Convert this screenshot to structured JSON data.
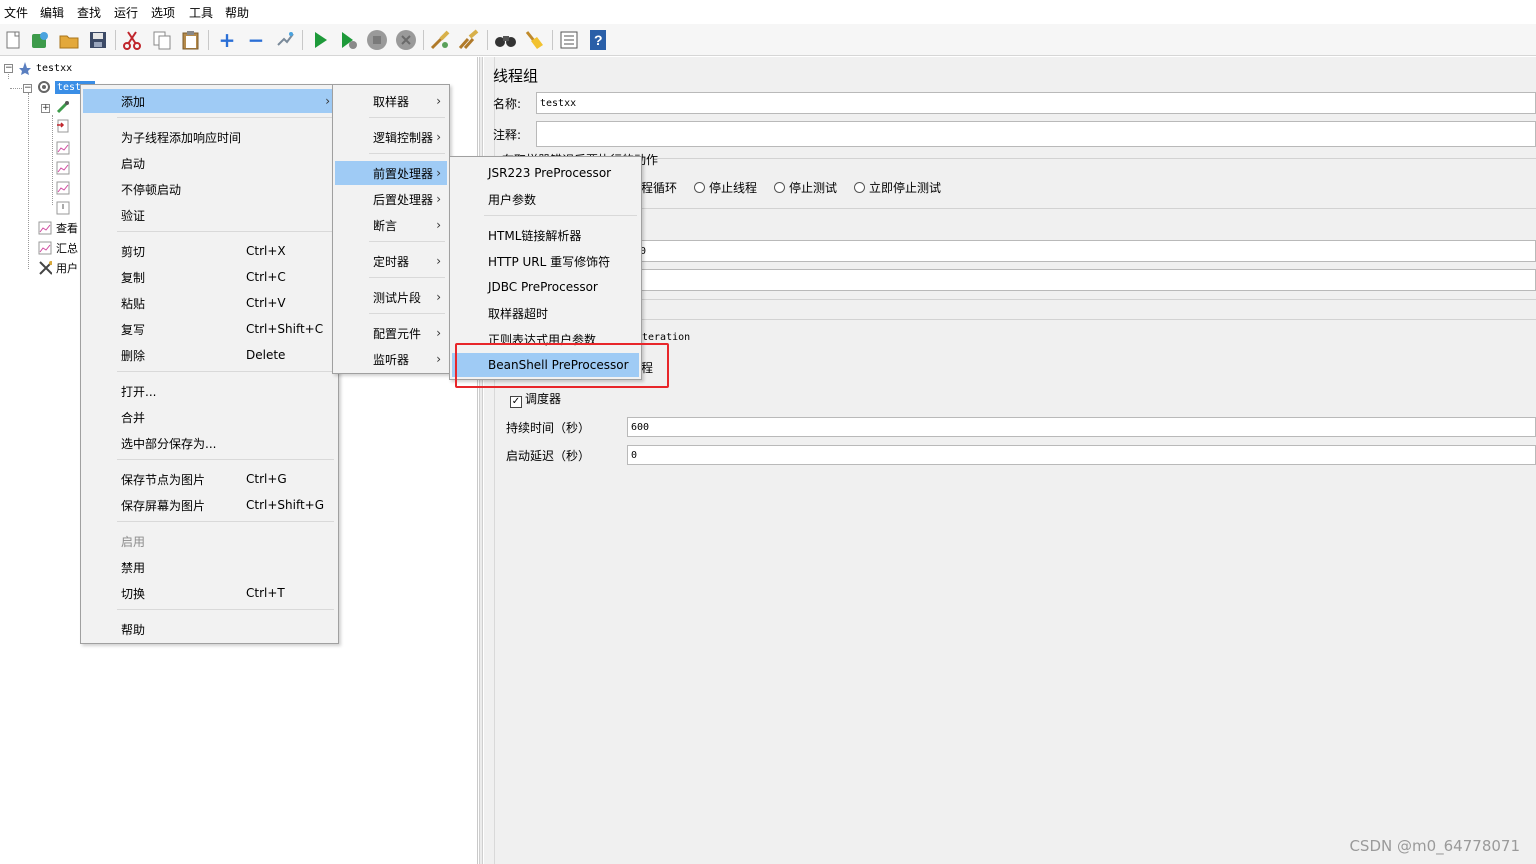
{
  "menubar": {
    "items": [
      "文件",
      "编辑",
      "查找",
      "运行",
      "选项",
      "工具",
      "帮助"
    ]
  },
  "toolbar": {
    "icons": [
      "new-icon",
      "templates-icon",
      "open-icon",
      "save-icon",
      "cut-icon",
      "copy-icon",
      "paste-icon",
      "expand-icon",
      "collapse-icon",
      "toggle-icon",
      "start-icon",
      "start-no-pause-icon",
      "stop-icon",
      "shutdown-icon",
      "clear-icon",
      "clear-all-icon",
      "search-icon",
      "reset-search-icon",
      "function-helper-icon",
      "help-icon"
    ]
  },
  "tree": {
    "root": "testxx",
    "thread_group": "test",
    "listeners": [
      "查看",
      "汇总",
      "用户"
    ]
  },
  "right_panel": {
    "title": "线程组",
    "name_label": "名称:",
    "name_value": "testxx",
    "comment_label": "注释:",
    "comment_value": "",
    "sampler_error_section_partial": "在取样器错误后要执行的动作",
    "radio_partial_continue": "程循环",
    "radio_stop_thread": "停止线程",
    "radio_stop_test": "停止测试",
    "radio_stop_test_now": "立即停止测试",
    "partial_value_1": "0",
    "partial_iteration": "teration",
    "partial_char": "程",
    "scheduler_label": "调度器",
    "scheduler_checked": true,
    "duration_label": "持续时间（秒）",
    "duration_value": "600",
    "startup_delay_label": "启动延迟（秒）",
    "startup_delay_value": "0"
  },
  "context_menu": {
    "items": [
      {
        "label": "添加",
        "shortcut": "",
        "submenu": true,
        "highlighted": true
      },
      {
        "label": "为子线程添加响应时间",
        "shortcut": ""
      },
      {
        "label": "启动",
        "shortcut": ""
      },
      {
        "label": "不停顿启动",
        "shortcut": ""
      },
      {
        "label": "验证",
        "shortcut": ""
      },
      {
        "label": "剪切",
        "shortcut": "Ctrl+X"
      },
      {
        "label": "复制",
        "shortcut": "Ctrl+C"
      },
      {
        "label": "粘贴",
        "shortcut": "Ctrl+V"
      },
      {
        "label": "复写",
        "shortcut": "Ctrl+Shift+C"
      },
      {
        "label": "删除",
        "shortcut": "Delete"
      },
      {
        "label": "打开...",
        "shortcut": ""
      },
      {
        "label": "合并",
        "shortcut": ""
      },
      {
        "label": "选中部分保存为...",
        "shortcut": ""
      },
      {
        "label": "保存节点为图片",
        "shortcut": "Ctrl+G"
      },
      {
        "label": "保存屏幕为图片",
        "shortcut": "Ctrl+Shift+G"
      },
      {
        "label": "启用",
        "shortcut": "",
        "disabled": true
      },
      {
        "label": "禁用",
        "shortcut": ""
      },
      {
        "label": "切换",
        "shortcut": "Ctrl+T"
      },
      {
        "label": "帮助",
        "shortcut": ""
      }
    ]
  },
  "add_submenu": {
    "items": [
      {
        "label": "取样器"
      },
      {
        "label": "逻辑控制器"
      },
      {
        "label": "前置处理器",
        "highlighted": true
      },
      {
        "label": "后置处理器"
      },
      {
        "label": "断言"
      },
      {
        "label": "定时器"
      },
      {
        "label": "测试片段"
      },
      {
        "label": "配置元件"
      },
      {
        "label": "监听器"
      }
    ]
  },
  "preprocessor_submenu": {
    "items": [
      {
        "label": "JSR223 PreProcessor"
      },
      {
        "label": "用户参数"
      },
      {
        "label": "HTML链接解析器"
      },
      {
        "label": "HTTP URL 重写修饰符"
      },
      {
        "label": "JDBC PreProcessor"
      },
      {
        "label": "取样器超时"
      },
      {
        "label": "正则表达式用户参数"
      },
      {
        "label": "BeanShell PreProcessor",
        "highlighted": true
      }
    ]
  },
  "colors": {
    "menu_highlight": "#9fcbf5",
    "annotation_red": "#e8262a",
    "panel_bg": "#f0f0f0",
    "selection_blue": "#3a8ee6"
  },
  "watermark": "CSDN @m0_64778071"
}
